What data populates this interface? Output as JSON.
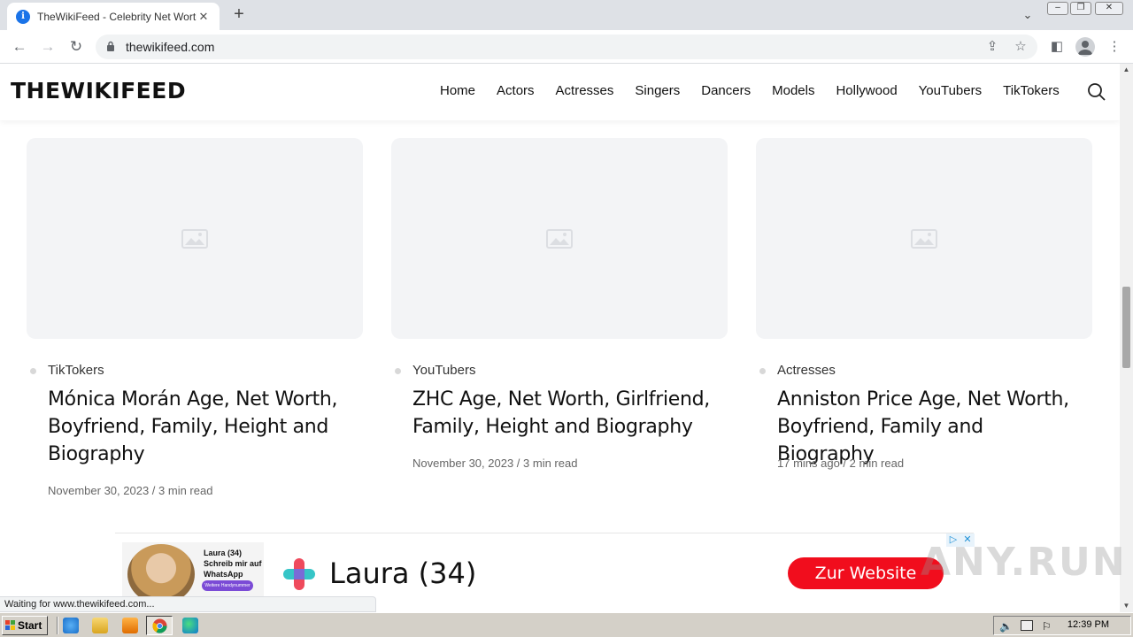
{
  "browser": {
    "tab_title": "TheWikiFeed - Celebrity Net Worth in...",
    "tab_close": "✕",
    "new_tab": "+",
    "url": "thewikifeed.com",
    "status_text": "Waiting for www.thewikifeed.com..."
  },
  "site": {
    "logo_text_1": "THEWIKIFEE",
    "logo_text_2": "D",
    "nav": [
      "Home",
      "Actors",
      "Actresses",
      "Singers",
      "Dancers",
      "Models",
      "Hollywood",
      "YouTubers",
      "TikTokers"
    ]
  },
  "cards": [
    {
      "category": "TikTokers",
      "title": "Mónica Morán Age, Net Worth, Boyfriend, Family, Height and Biography",
      "meta": "November 30, 2023 / 3 min read"
    },
    {
      "category": "YouTubers",
      "title": "ZHC Age, Net Worth, Girlfriend, Family, Height and Biography",
      "meta": "November 30, 2023 / 3 min read"
    },
    {
      "category": "Actresses",
      "title": "Anniston Price Age, Net Worth, Boyfriend, Family and Biography",
      "meta": "17 mins ago / 2 min read"
    }
  ],
  "ad": {
    "small_line_1": "Laura (34)",
    "small_line_2": "Schreib mir auf",
    "small_line_3": "WhatsApp",
    "pill_text": "Weitere Handynummer",
    "name": "Laura (34)",
    "button": "Zur Website"
  },
  "watermark": "ANY.RUN",
  "taskbar": {
    "start_label": "Start",
    "clock": "12:39 PM"
  },
  "colors": {
    "accent_red": "#e0202a",
    "ad_button": "#f10d1d",
    "thumb_bg": "#f3f4f6"
  }
}
